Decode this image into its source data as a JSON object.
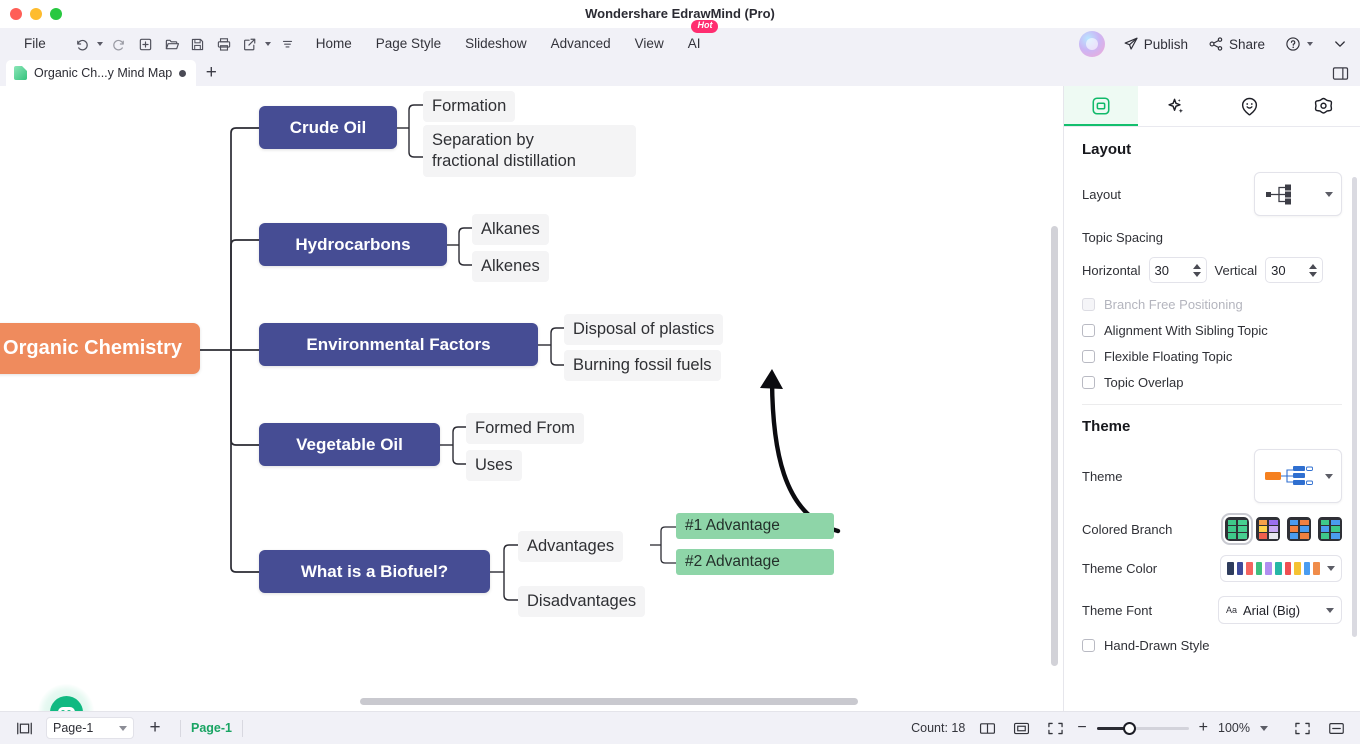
{
  "window": {
    "title": "Wondershare EdrawMind (Pro)",
    "traffic_lights": [
      "close",
      "minimize",
      "maximize"
    ]
  },
  "menubar": {
    "file_label": "File",
    "quick_tools": [
      {
        "name": "undo-button",
        "icon": "undo-icon",
        "has_caret": true
      },
      {
        "name": "redo-button",
        "icon": "redo-icon",
        "has_caret": false
      },
      {
        "name": "new-button",
        "icon": "new-file-icon",
        "has_caret": false
      },
      {
        "name": "open-button",
        "icon": "folder-open-icon",
        "has_caret": false
      },
      {
        "name": "save-button",
        "icon": "save-icon",
        "has_caret": false
      },
      {
        "name": "print-button",
        "icon": "print-icon",
        "has_caret": false
      },
      {
        "name": "export-button",
        "icon": "export-icon",
        "has_caret": true
      },
      {
        "name": "more-tools-button",
        "icon": "more-icon",
        "has_caret": false
      }
    ],
    "items": [
      "Home",
      "Page Style",
      "Slideshow",
      "Advanced",
      "View"
    ],
    "ai_label": "AI",
    "ai_badge": "Hot",
    "publish_label": "Publish",
    "share_label": "Share"
  },
  "tabbar": {
    "document_tab": "Organic Ch...y Mind Map",
    "add_tab": "+"
  },
  "canvas": {
    "nodes": [
      {
        "id": "root",
        "text": "Organic Chemistry",
        "type": "root"
      },
      {
        "id": "m1",
        "text": "Crude Oil",
        "type": "main"
      },
      {
        "id": "m2",
        "text": "Hydrocarbons",
        "type": "main"
      },
      {
        "id": "m3",
        "text": "Environmental Factors",
        "type": "main"
      },
      {
        "id": "m4",
        "text": "Vegetable Oil",
        "type": "main"
      },
      {
        "id": "m5",
        "text": "What is a Biofuel?",
        "type": "main"
      },
      {
        "id": "s1",
        "text": "Formation",
        "type": "sub"
      },
      {
        "id": "s2",
        "text": "Separation by\nfractional distillation",
        "type": "sub"
      },
      {
        "id": "s3",
        "text": "Alkanes",
        "type": "sub"
      },
      {
        "id": "s4",
        "text": "Alkenes",
        "type": "sub"
      },
      {
        "id": "s5",
        "text": "Disposal of plastics",
        "type": "sub"
      },
      {
        "id": "s6",
        "text": "Burning fossil fuels",
        "type": "sub"
      },
      {
        "id": "s7",
        "text": "Formed From",
        "type": "sub"
      },
      {
        "id": "s8",
        "text": "Uses",
        "type": "sub"
      },
      {
        "id": "s9",
        "text": "Advantages",
        "type": "sub"
      },
      {
        "id": "s10",
        "text": "Disadvantages",
        "type": "sub"
      },
      {
        "id": "l1",
        "text": "#1 Advantage",
        "type": "leaf"
      },
      {
        "id": "l2",
        "text": "#2 Advantage",
        "type": "leaf"
      }
    ],
    "colors": {
      "root": "#ef8b5d",
      "main": "#464d94",
      "sub": "#f4f4f5",
      "leaf": "#8ed5a8",
      "branch_line": "#2b2b33"
    },
    "ai_assistant": "ai-assistant-orb"
  },
  "panel": {
    "tabs": [
      {
        "name": "layout-tab",
        "icon": "layout-frame-icon",
        "active": true
      },
      {
        "name": "ai-tab",
        "icon": "sparkle-icon",
        "active": false
      },
      {
        "name": "clipart-tab",
        "icon": "smiley-pin-icon",
        "active": false
      },
      {
        "name": "settings-tab",
        "icon": "flower-gear-icon",
        "active": false
      }
    ],
    "layout_section": {
      "title": "Layout",
      "layout_label": "Layout",
      "layout_value": "right-map-layout",
      "spacing_title": "Topic Spacing",
      "horizontal_label": "Horizontal",
      "horizontal_value": "30",
      "vertical_label": "Vertical",
      "vertical_value": "30",
      "checkboxes": [
        {
          "label": "Branch Free Positioning",
          "checked": false,
          "disabled": true
        },
        {
          "label": "Alignment With Sibling Topic",
          "checked": false,
          "disabled": false
        },
        {
          "label": "Flexible Floating Topic",
          "checked": false,
          "disabled": false
        },
        {
          "label": "Topic Overlap",
          "checked": false,
          "disabled": false
        }
      ]
    },
    "theme_section": {
      "title": "Theme",
      "theme_label": "Theme",
      "colored_branch_label": "Colored Branch",
      "colored_branch_selected": 0,
      "colored_branch_swatches": [
        [
          "#3ec98a",
          "#46cf90",
          "#3ec98a",
          "#46cf90",
          "#3ec98a",
          "#46cf90"
        ],
        [
          "#f7a14a",
          "#9b6ff0",
          "#ffd24a",
          "#c8a8f5",
          "#f0604d",
          "#e8e8ef"
        ],
        [
          "#4a9cf0",
          "#f08040",
          "#f08040",
          "#4a9cf0",
          "#4a9cf0",
          "#f08040"
        ],
        [
          "#3ec98a",
          "#4a9cf0",
          "#4a9cf0",
          "#3ec98a",
          "#3ec98a",
          "#4a9cf0"
        ]
      ],
      "theme_color_label": "Theme Color",
      "theme_palette": [
        "#2e3c5c",
        "#3f4b9b",
        "#f5655f",
        "#3fbf7f",
        "#b08ef0",
        "#26b7a6",
        "#ef4f52",
        "#f5c232",
        "#4a9cf0",
        "#f08c4a"
      ],
      "theme_font_label": "Theme Font",
      "theme_font_value": "Arial (Big)",
      "hand_drawn_label": "Hand-Drawn Style",
      "hand_drawn_checked": false
    }
  },
  "statusbar": {
    "page_select_value": "Page-1",
    "add_page": "+",
    "active_page": "Page-1",
    "count_label": "Count: 18",
    "zoom_value": "100%",
    "zoom_minus": "−",
    "zoom_plus": "+"
  }
}
